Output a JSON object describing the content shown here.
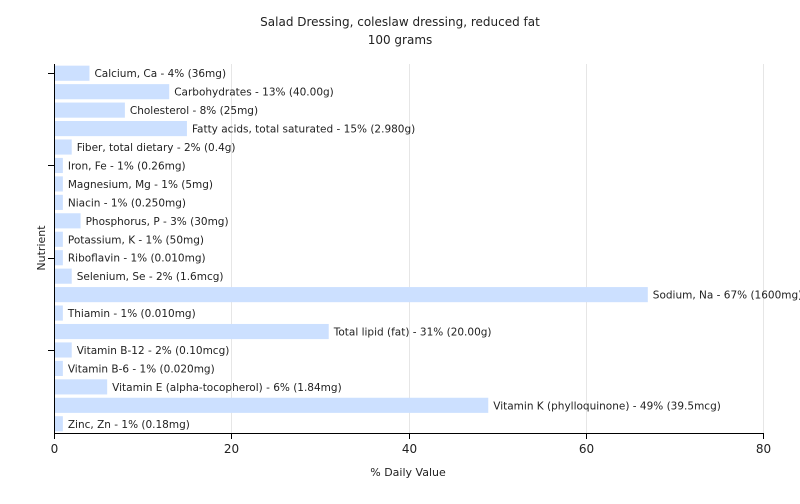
{
  "chart_data": {
    "type": "bar",
    "orientation": "horizontal",
    "title": "Salad Dressing, coleslaw dressing, reduced fat",
    "subtitle": "100 grams",
    "xlabel": "% Daily Value",
    "ylabel": "Nutrient",
    "xlim": [
      0,
      80
    ],
    "xticks": [
      0,
      20,
      40,
      60,
      80
    ],
    "grid": true,
    "bar_color": "#cce0ff",
    "grid_color": "#e6e6e6",
    "axis_color": "#000000",
    "categories": [
      "Calcium, Ca",
      "Carbohydrates",
      "Cholesterol",
      "Fatty acids, total saturated",
      "Fiber, total dietary",
      "Iron, Fe",
      "Magnesium, Mg",
      "Niacin",
      "Phosphorus, P",
      "Potassium, K",
      "Riboflavin",
      "Selenium, Se",
      "Sodium, Na",
      "Thiamin",
      "Total lipid (fat)",
      "Vitamin B-12",
      "Vitamin B-6",
      "Vitamin E (alpha-tocopherol)",
      "Vitamin K (phylloquinone)",
      "Zinc, Zn"
    ],
    "values": [
      4,
      13,
      8,
      15,
      2,
      1,
      1,
      1,
      3,
      1,
      1,
      2,
      67,
      1,
      31,
      2,
      1,
      6,
      49,
      1
    ],
    "labels": [
      "Calcium, Ca - 4% (36mg)",
      "Carbohydrates - 13% (40.00g)",
      "Cholesterol - 8% (25mg)",
      "Fatty acids, total saturated - 15% (2.980g)",
      "Fiber, total dietary - 2% (0.4g)",
      "Iron, Fe - 1% (0.26mg)",
      "Magnesium, Mg - 1% (5mg)",
      "Niacin - 1% (0.250mg)",
      "Phosphorus, P - 3% (30mg)",
      "Potassium, K - 1% (50mg)",
      "Riboflavin - 1% (0.010mg)",
      "Selenium, Se - 2% (1.6mcg)",
      "Sodium, Na - 67% (1600mg)",
      "Thiamin - 1% (0.010mg)",
      "Total lipid (fat) - 31% (20.00g)",
      "Vitamin B-12 - 2% (0.10mcg)",
      "Vitamin B-6 - 1% (0.020mg)",
      "Vitamin E (alpha-tocopherol) - 6% (1.84mg)",
      "Vitamin K (phylloquinone) - 49% (39.5mcg)",
      "Zinc, Zn - 1% (0.18mg)"
    ]
  }
}
